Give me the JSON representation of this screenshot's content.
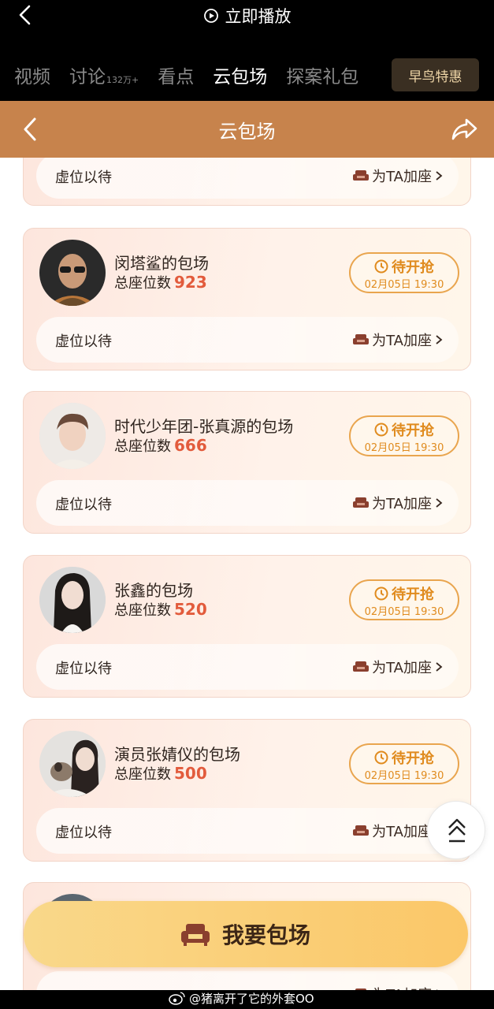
{
  "topbar": {
    "play_now": "立即播放",
    "tabs": [
      {
        "label": "视频",
        "count": ""
      },
      {
        "label": "讨论",
        "count": "132万+"
      },
      {
        "label": "看点",
        "count": ""
      },
      {
        "label": "云包场",
        "count": ""
      },
      {
        "label": "探案礼包",
        "count": ""
      }
    ],
    "active_tab": "云包场",
    "early_bird": "早鸟特惠"
  },
  "header": {
    "title": "云包场"
  },
  "cards": [
    {
      "name": "",
      "seats_label": "",
      "seats": "",
      "status": "",
      "time": "",
      "vacant": "虚位以待",
      "add_label": "为TA加座"
    },
    {
      "name": "闵塔鲨的包场",
      "seats_label": "总座位数",
      "seats": "923",
      "status": "待开抢",
      "time": "02月05日 19:30",
      "vacant": "虚位以待",
      "add_label": "为TA加座"
    },
    {
      "name": "时代少年团-张真源的包场",
      "seats_label": "总座位数",
      "seats": "666",
      "status": "待开抢",
      "time": "02月05日 19:30",
      "vacant": "虚位以待",
      "add_label": "为TA加座"
    },
    {
      "name": "张鑫的包场",
      "seats_label": "总座位数",
      "seats": "520",
      "status": "待开抢",
      "time": "02月05日 19:30",
      "vacant": "虚位以待",
      "add_label": "为TA加座"
    },
    {
      "name": "演员张婧仪的包场",
      "seats_label": "总座位数",
      "seats": "500",
      "status": "待开抢",
      "time": "02月05日 19:30",
      "vacant": "虚位以待",
      "add_label": "为TA加座"
    },
    {
      "name": "",
      "seats_label": "",
      "seats": "",
      "status": "",
      "time": "",
      "vacant": "",
      "add_label": "为TA加座"
    }
  ],
  "book_button": "我要包场",
  "watermark": "@猪离开了它的外套OO",
  "colors": {
    "header_brown": "#c7834c",
    "seat_number": "#e25b3c",
    "status_orange": "#e08b1e",
    "button_yellow": "#fbc768"
  },
  "icons": [
    "back-arrow-icon",
    "play-circle-icon",
    "share-icon",
    "clock-icon",
    "sofa-icon",
    "chevron-right-icon",
    "scroll-top-icon",
    "weibo-icon"
  ]
}
